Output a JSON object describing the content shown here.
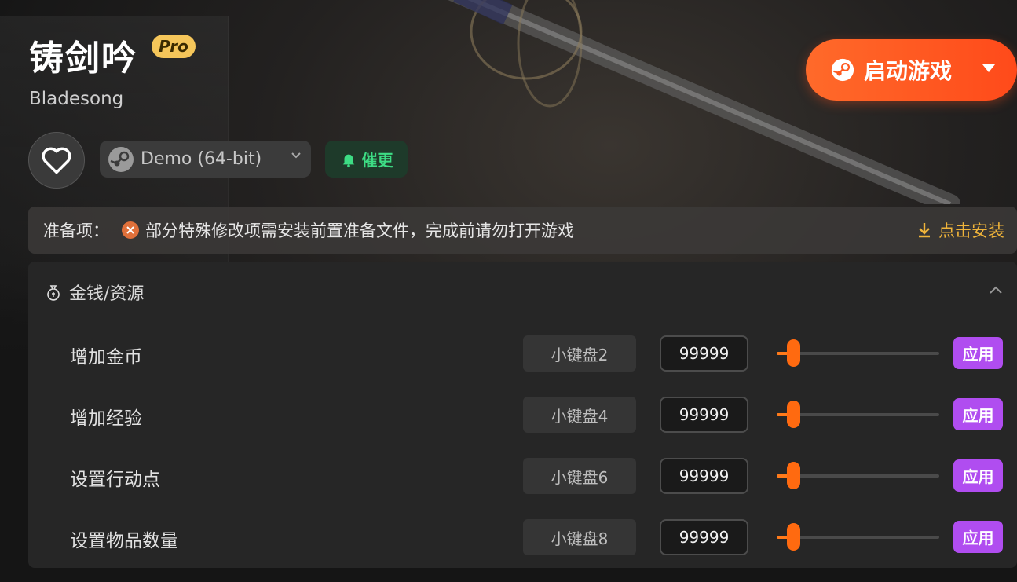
{
  "game": {
    "title": "铸剑吟",
    "badge": "Pro",
    "subtitle": "Bladesong"
  },
  "version_select": {
    "value": "Demo (64-bit)"
  },
  "remind_button": {
    "label": "催更"
  },
  "launch_button": {
    "label": "启动游戏"
  },
  "prep": {
    "label": "准备项：",
    "message": "部分特殊修改项需安装前置准备文件，完成前请勿打开游戏",
    "install_label": "点击安装"
  },
  "section": {
    "title": "金钱/资源",
    "rows": [
      {
        "name": "增加金币",
        "hotkey": "小键盘2",
        "value": "99999",
        "slider_fraction": 0.1,
        "apply": "应用"
      },
      {
        "name": "增加经验",
        "hotkey": "小键盘4",
        "value": "99999",
        "slider_fraction": 0.1,
        "apply": "应用"
      },
      {
        "name": "设置行动点",
        "hotkey": "小键盘6",
        "value": "99999",
        "slider_fraction": 0.1,
        "apply": "应用"
      },
      {
        "name": "设置物品数量",
        "hotkey": "小键盘8",
        "value": "99999",
        "slider_fraction": 0.1,
        "apply": "应用"
      }
    ]
  },
  "colors": {
    "accent_orange": "#ff5a20",
    "apply_purple": "#b04df0",
    "remind_green": "#3ddc84",
    "install_gold": "#f0b43a",
    "pro_badge": "#f5c65a"
  }
}
